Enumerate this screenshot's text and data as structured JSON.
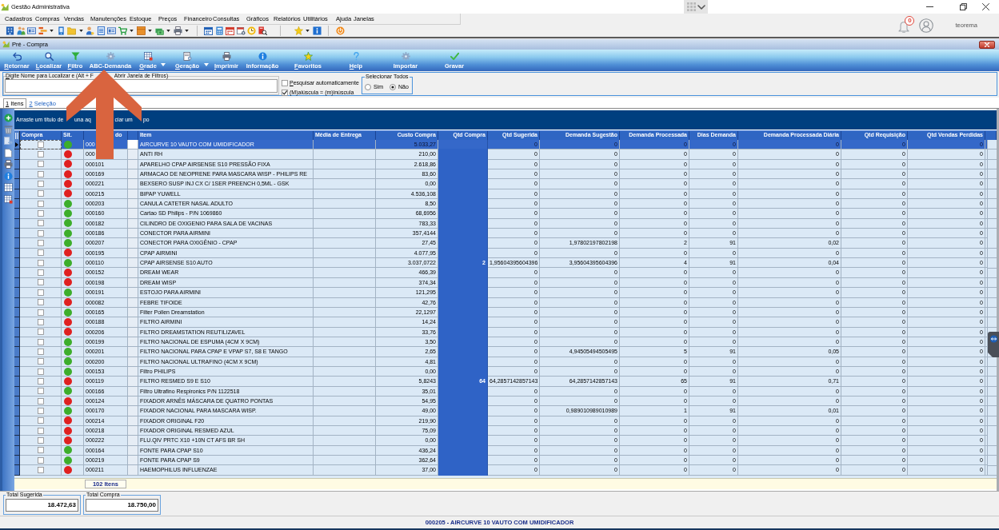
{
  "app": {
    "title": "Gestão Administrativa"
  },
  "menu": [
    "Cadastros",
    "Compras",
    "Vendas",
    "Manutenções",
    "Estoque",
    "Preços",
    "Financeiro",
    "Consultas",
    "Gráficos",
    "Relatórios",
    "Utilitários",
    "Ajuda",
    "Janelas"
  ],
  "user": {
    "notifications": "0",
    "name": "teorema"
  },
  "child_window": {
    "title": "Pré - Compra"
  },
  "toolbar": [
    {
      "label": "Retornar",
      "mnemonic": true,
      "dropdown": false
    },
    {
      "label": "Localizar",
      "mnemonic": true,
      "dropdown": false
    },
    {
      "label": "Filtro",
      "mnemonic": true,
      "dropdown": false
    },
    {
      "label": "ABC-Demanda",
      "mnemonic": false,
      "dropdown": false
    },
    {
      "label": "Grade",
      "mnemonic": true,
      "dropdown": true
    },
    {
      "label": "Geração",
      "mnemonic": true,
      "dropdown": true
    },
    {
      "label": "Imprimir",
      "mnemonic": true,
      "dropdown": false
    },
    {
      "label": "Informação",
      "mnemonic": false,
      "dropdown": false
    },
    {
      "label": "Favoritos",
      "mnemonic": true,
      "dropdown": false
    },
    {
      "label": "Help",
      "mnemonic": true,
      "dropdown": false
    },
    {
      "label": "Importar",
      "mnemonic": false,
      "dropdown": false
    },
    {
      "label": "Gravar",
      "mnemonic": false,
      "dropdown": false
    }
  ],
  "search": {
    "legend_parts": [
      {
        "text": "Digite Nome para Localizar e (Alt + F",
        "mnemonic": true
      },
      {
        "text": "Abrir Janela de Filtros)",
        "mnemonic": false
      }
    ]
  },
  "options": [
    {
      "label": "Pesquisar automaticamente",
      "mnemonic": true,
      "checked": false
    },
    {
      "label": "(M)aiúscula = (m)inúscula",
      "mnemonic": false,
      "checked": true
    }
  ],
  "select_all": {
    "title": "Selecionar Todos",
    "options": [
      {
        "label": "Sim",
        "selected": false
      },
      {
        "label": "Não",
        "selected": true
      }
    ]
  },
  "tabs": [
    {
      "label": "1 Itens",
      "mnemonic": true,
      "selected": true
    },
    {
      "label": "2 Seleção",
      "mnemonic": true,
      "selected": false
    }
  ],
  "grid": {
    "group_hint_parts": [
      "Arraste um título de",
      "una aq",
      "ciar um",
      "po"
    ],
    "columns": [
      "Compra",
      "Sit.",
      "do",
      "Item",
      "Média de Entrega",
      "Custo Compra",
      "Qtd Compra",
      "Qtd Sugerida",
      "Demanda Sugestão",
      "Demanda Processada",
      "Dias Demanda",
      "Demanda Processada Diária",
      "Qtd Requisição",
      "Qtd Vendas Perdidas"
    ],
    "rows": [
      {
        "selected": true,
        "checked": false,
        "color": "#3dae2b",
        "code": "000",
        "item": "AIRCURVE 10 VAUTO COM UMIDIFICADOR",
        "cost": "5.033,27",
        "numbers": [
          "0",
          "0",
          "0",
          "0",
          "0",
          "0",
          "0"
        ]
      },
      {
        "selected": false,
        "checked": false,
        "color": "#e02020",
        "code": "000",
        "item": "ANTI RH",
        "cost": "210,00",
        "numbers": [
          "0",
          "0",
          "0",
          "0",
          "0",
          "0",
          "0"
        ]
      },
      {
        "selected": false,
        "checked": false,
        "color": "#e02020",
        "code": "000101",
        "item": "APARELHO CPAP AIRSENSE S10 PRESSÃO FIXA",
        "cost": "2.618,86",
        "numbers": [
          "0",
          "0",
          "0",
          "0",
          "0",
          "0",
          "0"
        ]
      },
      {
        "selected": false,
        "checked": false,
        "color": "#e02020",
        "code": "000169",
        "item": "ARMACAO DE NEOPRENE PARA MASCARA WISP - PHILIPS RE",
        "cost": "83,60",
        "numbers": [
          "0",
          "0",
          "0",
          "0",
          "0",
          "0",
          "0"
        ]
      },
      {
        "selected": false,
        "checked": false,
        "color": "#e02020",
        "code": "000221",
        "item": "BEXSERO SUSP INJ CX C/ 1SER PREENCH 0,5ML - GSK",
        "cost": "0,00",
        "numbers": [
          "0",
          "0",
          "0",
          "0",
          "0",
          "0",
          "0"
        ]
      },
      {
        "selected": false,
        "checked": false,
        "color": "#e02020",
        "code": "000215",
        "item": "BIPAP YUWELL",
        "cost": "4.536,108",
        "numbers": [
          "0",
          "0",
          "0",
          "0",
          "0",
          "0",
          "0"
        ]
      },
      {
        "selected": false,
        "checked": false,
        "color": "#3dae2b",
        "code": "000203",
        "item": "CANULA CATETER NASAL ADULTO",
        "cost": "8,50",
        "numbers": [
          "0",
          "0",
          "0",
          "0",
          "0",
          "0",
          "0"
        ]
      },
      {
        "selected": false,
        "checked": false,
        "color": "#3dae2b",
        "code": "000160",
        "item": "Cartao SD Philips - P/N 1069860",
        "cost": "68,6956",
        "numbers": [
          "0",
          "0",
          "0",
          "0",
          "0",
          "0",
          "0"
        ]
      },
      {
        "selected": false,
        "checked": false,
        "color": "#3dae2b",
        "code": "000182",
        "item": "CILINDRO DE OXIGENIO PARA SALA DE VACINAS",
        "cost": "783,33",
        "numbers": [
          "0",
          "0",
          "0",
          "0",
          "0",
          "0",
          "0"
        ]
      },
      {
        "selected": false,
        "checked": false,
        "color": "#3dae2b",
        "code": "000186",
        "item": "CONECTOR PARA AIRMINI",
        "cost": "357,4144",
        "numbers": [
          "0",
          "0",
          "0",
          "0",
          "0",
          "0",
          "0"
        ]
      },
      {
        "selected": false,
        "checked": false,
        "color": "#3dae2b",
        "code": "000207",
        "item": "CONECTOR PARA OXIGÊNIO - CPAP",
        "cost": "27,45",
        "numbers": [
          "0",
          "1,97802197802198",
          "2",
          "91",
          "0,02",
          "0",
          "0"
        ]
      },
      {
        "selected": false,
        "checked": false,
        "color": "#e02020",
        "code": "000195",
        "item": "CPAP AIRMINI",
        "cost": "4.077,95",
        "numbers": [
          "0",
          "0",
          "0",
          "0",
          "0",
          "0",
          "0"
        ]
      },
      {
        "selected": false,
        "checked": false,
        "color": "#3dae2b",
        "code": "000110",
        "item": "CPAP AIRSENSE S10 AUTO",
        "cost": "3.037,0722",
        "qtd_compra": "2",
        "numbers": [
          "1,95604395604396",
          "3,95604395604396",
          "4",
          "91",
          "0,04",
          "0",
          "0"
        ]
      },
      {
        "selected": false,
        "checked": false,
        "color": "#e02020",
        "code": "000152",
        "item": "DREAM WEAR",
        "cost": "466,39",
        "numbers": [
          "0",
          "0",
          "0",
          "0",
          "0",
          "0",
          "0"
        ]
      },
      {
        "selected": false,
        "checked": false,
        "color": "#e02020",
        "code": "000198",
        "item": "DREAM WISP",
        "cost": "374,34",
        "numbers": [
          "0",
          "0",
          "0",
          "0",
          "0",
          "0",
          "0"
        ]
      },
      {
        "selected": false,
        "checked": false,
        "color": "#3dae2b",
        "code": "000191",
        "item": "ESTOJO PARA AIRMINI",
        "cost": "121,295",
        "numbers": [
          "0",
          "0",
          "0",
          "0",
          "0",
          "0",
          "0"
        ]
      },
      {
        "selected": false,
        "checked": false,
        "color": "#e02020",
        "code": "000082",
        "item": "FEBRE TIFOIDE",
        "cost": "42,76",
        "numbers": [
          "0",
          "0",
          "0",
          "0",
          "0",
          "0",
          "0"
        ]
      },
      {
        "selected": false,
        "checked": false,
        "color": "#3dae2b",
        "code": "000165",
        "item": "Filter Pollen Dreamstation",
        "cost": "22,1297",
        "numbers": [
          "0",
          "0",
          "0",
          "0",
          "0",
          "0",
          "0"
        ]
      },
      {
        "selected": false,
        "checked": false,
        "color": "#e02020",
        "code": "000188",
        "item": "FILTRO AIRMINI",
        "cost": "14,24",
        "numbers": [
          "0",
          "0",
          "0",
          "0",
          "0",
          "0",
          "0"
        ]
      },
      {
        "selected": false,
        "checked": false,
        "color": "#e02020",
        "code": "000206",
        "item": "FILTRO DREAMSTATION REUTILIZAVEL",
        "cost": "33,76",
        "numbers": [
          "0",
          "0",
          "0",
          "0",
          "0",
          "0",
          "0"
        ]
      },
      {
        "selected": false,
        "checked": false,
        "color": "#3dae2b",
        "code": "000199",
        "item": "FILTRO NACIONAL DE ESPUMA (4CM X 9CM)",
        "cost": "3,50",
        "numbers": [
          "0",
          "0",
          "0",
          "0",
          "0",
          "0",
          "0"
        ]
      },
      {
        "selected": false,
        "checked": false,
        "color": "#3dae2b",
        "code": "000201",
        "item": "FILTRO NACIONAL PARA CPAP E VPAP S7, S8 E TANGO",
        "cost": "2,65",
        "numbers": [
          "0",
          "4,94505494505495",
          "5",
          "91",
          "0,05",
          "0",
          "0"
        ]
      },
      {
        "selected": false,
        "checked": false,
        "color": "#3dae2b",
        "code": "000200",
        "item": "FILTRO NACIONAL ULTRAFINO (4CM X 9CM)",
        "cost": "4,81",
        "numbers": [
          "0",
          "0",
          "0",
          "0",
          "0",
          "0",
          "0"
        ]
      },
      {
        "selected": false,
        "checked": false,
        "color": "#3dae2b",
        "code": "000153",
        "item": "Filtro PHILIPS",
        "cost": "0,00",
        "numbers": [
          "0",
          "0",
          "0",
          "0",
          "0",
          "0",
          "0"
        ]
      },
      {
        "selected": false,
        "checked": false,
        "color": "#e02020",
        "code": "000119",
        "item": "FILTRO RESMED S9 E S10",
        "cost": "5,8243",
        "qtd_compra": "64",
        "numbers": [
          "64,2857142857143",
          "64,2857142857143",
          "65",
          "91",
          "0,71",
          "0",
          "0"
        ]
      },
      {
        "selected": false,
        "checked": false,
        "color": "#3dae2b",
        "code": "000166",
        "item": "Filtro Ultrafino Respironics P/N 1122518",
        "cost": "35,01",
        "numbers": [
          "0",
          "0",
          "0",
          "0",
          "0",
          "0",
          "0"
        ]
      },
      {
        "selected": false,
        "checked": false,
        "color": "#e02020",
        "code": "000124",
        "item": "FIXADOR ARNÊS MÁSCARA DE QUATRO PONTAS",
        "cost": "54,95",
        "numbers": [
          "0",
          "0",
          "0",
          "0",
          "0",
          "0",
          "0"
        ]
      },
      {
        "selected": false,
        "checked": false,
        "color": "#3dae2b",
        "code": "000170",
        "item": "FIXADOR NACIONAL PARA MASCARA WISP.",
        "cost": "49,00",
        "numbers": [
          "0",
          "0,989010989010989",
          "1",
          "91",
          "0,01",
          "0",
          "0"
        ]
      },
      {
        "selected": false,
        "checked": false,
        "color": "#e02020",
        "code": "000214",
        "item": "FIXADOR ORIGINAL F20",
        "cost": "219,90",
        "numbers": [
          "0",
          "0",
          "0",
          "0",
          "0",
          "0",
          "0"
        ]
      },
      {
        "selected": false,
        "checked": false,
        "color": "#e02020",
        "code": "000218",
        "item": "FIXADOR ORIGINAL RESMED AZUL",
        "cost": "75,09",
        "numbers": [
          "0",
          "0",
          "0",
          "0",
          "0",
          "0",
          "0"
        ]
      },
      {
        "selected": false,
        "checked": false,
        "color": "#e02020",
        "code": "000222",
        "item": "FLU.QIV PRTC X10 +10N CT AFS BR SH",
        "cost": "0,00",
        "numbers": [
          "0",
          "0",
          "0",
          "0",
          "0",
          "0",
          "0"
        ]
      },
      {
        "selected": false,
        "checked": false,
        "color": "#3dae2b",
        "code": "000164",
        "item": "FONTE PARA CPAP S10",
        "cost": "436,24",
        "numbers": [
          "0",
          "0",
          "0",
          "0",
          "0",
          "0",
          "0"
        ]
      },
      {
        "selected": false,
        "checked": false,
        "color": "#3dae2b",
        "code": "000219",
        "item": "FONTE PARA CPAP S9",
        "cost": "362,64",
        "numbers": [
          "0",
          "0",
          "0",
          "0",
          "0",
          "0",
          "0"
        ]
      },
      {
        "selected": false,
        "checked": false,
        "color": "#e02020",
        "code": "000211",
        "item": "HAEMOPHILUS INFLUENZAE",
        "cost": "37,00",
        "numbers": [
          "0",
          "0",
          "0",
          "0",
          "0",
          "0",
          "0"
        ]
      }
    ],
    "footer": "102 Itens"
  },
  "totals": [
    {
      "label": "Total Sugerida",
      "value": "18.472,63"
    },
    {
      "label": "Total Compra",
      "value": "18.750,00"
    }
  ],
  "status_bar": "000205 - AIRCURVE 10 VAUTO COM UMIDIFICADOR"
}
